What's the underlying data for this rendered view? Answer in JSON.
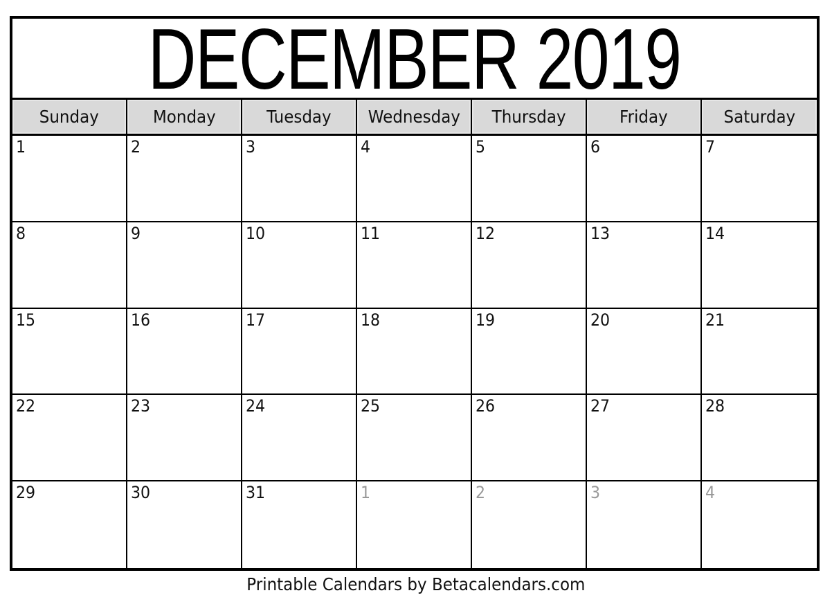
{
  "calendar": {
    "title": "DECEMBER 2019",
    "month": "December",
    "year": 2019,
    "weekdays": [
      "Sunday",
      "Monday",
      "Tuesday",
      "Wednesday",
      "Thursday",
      "Friday",
      "Saturday"
    ],
    "weeks": [
      [
        {
          "day": "1",
          "current_month": true
        },
        {
          "day": "2",
          "current_month": true
        },
        {
          "day": "3",
          "current_month": true
        },
        {
          "day": "4",
          "current_month": true
        },
        {
          "day": "5",
          "current_month": true
        },
        {
          "day": "6",
          "current_month": true
        },
        {
          "day": "7",
          "current_month": true
        }
      ],
      [
        {
          "day": "8",
          "current_month": true
        },
        {
          "day": "9",
          "current_month": true
        },
        {
          "day": "10",
          "current_month": true
        },
        {
          "day": "11",
          "current_month": true
        },
        {
          "day": "12",
          "current_month": true
        },
        {
          "day": "13",
          "current_month": true
        },
        {
          "day": "14",
          "current_month": true
        }
      ],
      [
        {
          "day": "15",
          "current_month": true
        },
        {
          "day": "16",
          "current_month": true
        },
        {
          "day": "17",
          "current_month": true
        },
        {
          "day": "18",
          "current_month": true
        },
        {
          "day": "19",
          "current_month": true
        },
        {
          "day": "20",
          "current_month": true
        },
        {
          "day": "21",
          "current_month": true
        }
      ],
      [
        {
          "day": "22",
          "current_month": true
        },
        {
          "day": "23",
          "current_month": true
        },
        {
          "day": "24",
          "current_month": true
        },
        {
          "day": "25",
          "current_month": true
        },
        {
          "day": "26",
          "current_month": true
        },
        {
          "day": "27",
          "current_month": true
        },
        {
          "day": "28",
          "current_month": true
        }
      ],
      [
        {
          "day": "29",
          "current_month": true
        },
        {
          "day": "30",
          "current_month": true
        },
        {
          "day": "31",
          "current_month": true
        },
        {
          "day": "1",
          "current_month": false
        },
        {
          "day": "2",
          "current_month": false
        },
        {
          "day": "3",
          "current_month": false
        },
        {
          "day": "4",
          "current_month": false
        }
      ]
    ]
  },
  "footer": {
    "credit": "Printable Calendars by Betacalendars.com"
  },
  "colors": {
    "border": "#000000",
    "header_bg": "#d9d9d9",
    "other_month_text": "#999999"
  }
}
